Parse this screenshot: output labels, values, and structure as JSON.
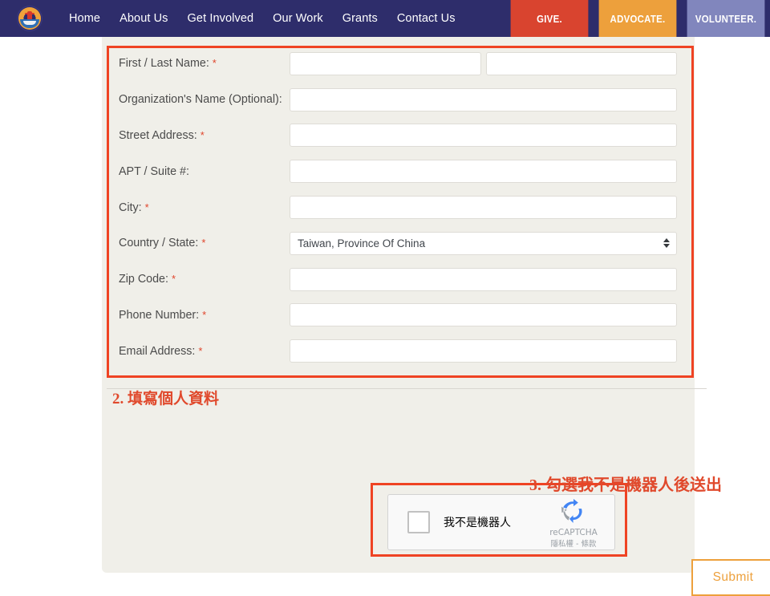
{
  "nav": {
    "logo_alt": "organization-logo",
    "links": [
      {
        "label": "Home"
      },
      {
        "label": "About Us"
      },
      {
        "label": "Get Involved"
      },
      {
        "label": "Our Work"
      },
      {
        "label": "Grants"
      },
      {
        "label": "Contact Us"
      }
    ],
    "ctas": [
      {
        "label": "GIVE.",
        "color": "#d9442f"
      },
      {
        "label": "ADVOCATE.",
        "color": "#eda03c"
      },
      {
        "label": "VOLUNTEER.",
        "color": "#8186bd"
      }
    ],
    "bar_color": "#2e2d6b"
  },
  "form": {
    "rows": [
      {
        "label": "First / Last Name:",
        "required": true,
        "type": "double-text",
        "value_first": "",
        "value_last": ""
      },
      {
        "label": "Organization's Name (Optional):",
        "required": false,
        "type": "text",
        "value": ""
      },
      {
        "label": "Street Address:",
        "required": true,
        "type": "text",
        "value": ""
      },
      {
        "label": "APT / Suite #:",
        "required": false,
        "type": "text",
        "value": ""
      },
      {
        "label": "City:",
        "required": true,
        "type": "text",
        "value": ""
      },
      {
        "label": "Country / State:",
        "required": true,
        "type": "select",
        "value": "Taiwan, Province Of China"
      },
      {
        "label": "Zip Code:",
        "required": true,
        "type": "text",
        "value": ""
      },
      {
        "label": "Phone Number:",
        "required": true,
        "type": "text",
        "value": ""
      },
      {
        "label": "Email Address:",
        "required": true,
        "type": "text",
        "value": ""
      }
    ],
    "required_marker": "*"
  },
  "annotations": {
    "color": "#e0492c",
    "step2": "2. 填寫個人資料",
    "step3": "3. 勾選我不是機器人後送出"
  },
  "recaptcha": {
    "checkbox_label": "我不是機器人",
    "brand_name": "reCAPTCHA",
    "terms": "隱私權 - 條款",
    "logo_icon": "recaptcha-icon"
  },
  "submit": {
    "label": "Submit",
    "color": "#eda03c"
  }
}
